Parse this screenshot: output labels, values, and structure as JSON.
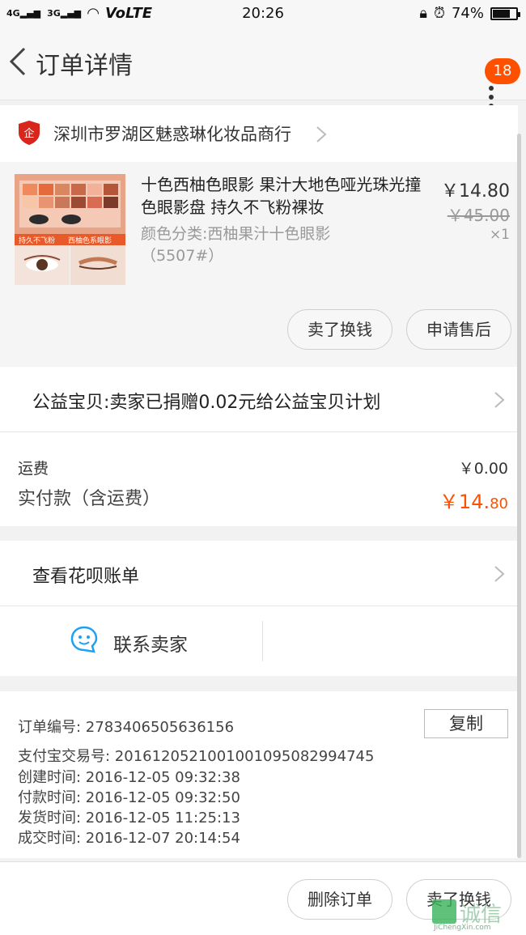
{
  "status_bar": {
    "network": "VoLTE",
    "signal_1": "4G",
    "signal_2": "3G",
    "time": "20:26",
    "battery": "74%",
    "battery_level": 0.74
  },
  "header": {
    "back_icon": "chevron-left-icon",
    "title": "订单详情",
    "badge_count": "18",
    "more_icon": "more-vertical-icon"
  },
  "shop": {
    "name": "深圳市罗湖区魅惑琳化妆品商行",
    "icon": "enterprise-shield-icon"
  },
  "item": {
    "title": "十色西柚色眼影 果汁大地色哑光珠光撞色眼影盘 持久不飞粉裸妆",
    "sku": "颜色分类:西柚果汁十色眼影（5507#）",
    "price": "￥14.80",
    "original_price": "￥45.00",
    "quantity": "×1",
    "thumb_caption_1": "持久不飞粉",
    "thumb_caption_2": "西柚色系眼影"
  },
  "item_actions": {
    "resell": "卖了换钱",
    "after_sale": "申请售后"
  },
  "charity": {
    "text": "公益宝贝:卖家已捐赠0.02元给公益宝贝计划"
  },
  "summary": {
    "shipping_label": "运费",
    "shipping_value": "￥0.00",
    "paid_label": "实付款（含运费）",
    "paid_main": "￥14.",
    "paid_cents": "80",
    "accent_color": "#ff5000"
  },
  "huabei": {
    "text": "查看花呗账单"
  },
  "contact": {
    "text": "联系卖家",
    "icon": "chat-bubble-icon"
  },
  "order_info": {
    "order_no": "订单编号:   2783406505636156",
    "copy": "复制",
    "alipay_no": "支付宝交易号:   2016120521001001095082994745",
    "created": "创建时间:   2016-12-05 09:32:38",
    "paid": "付款时间:   2016-12-05 09:32:50",
    "shipped": "发货时间:   2016-12-05 11:25:13",
    "completed": "成交时间:   2016-12-07 20:14:54"
  },
  "bottom_bar": {
    "delete": "删除订单",
    "resell": "卖了换钱"
  },
  "watermark": {
    "text": "JiChengXin.com",
    "logo_text": "诚信"
  }
}
